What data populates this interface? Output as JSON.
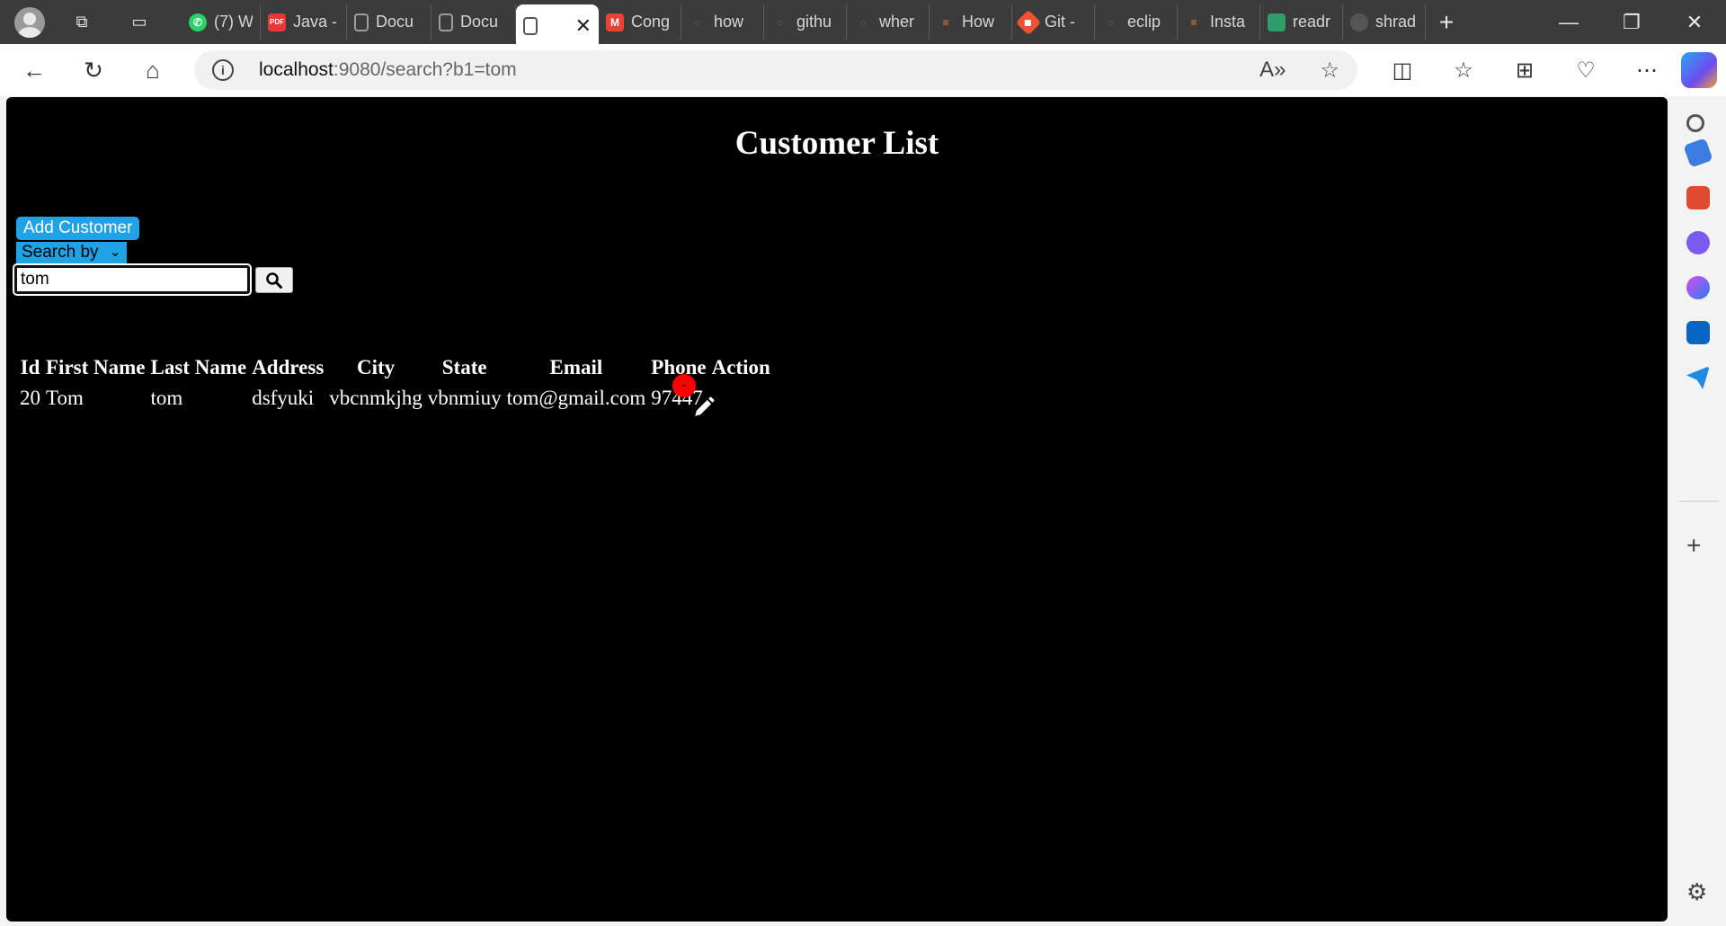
{
  "browser": {
    "tabs": [
      {
        "title": "(7) W",
        "icon": "whatsapp-icon",
        "color": "#25d366"
      },
      {
        "title": "Java -",
        "icon": "pdf-icon",
        "color": "#e53935"
      },
      {
        "title": "Docu",
        "icon": "document-icon",
        "color": "#9e9e9e"
      },
      {
        "title": "Docu",
        "icon": "document-icon",
        "color": "#9e9e9e"
      },
      {
        "title": "",
        "icon": "document-icon",
        "color": "#555555",
        "active": true
      },
      {
        "title": "Cong",
        "icon": "gmail-icon",
        "color": "#ea4335"
      },
      {
        "title": "how",
        "icon": "search-icon",
        "color": "#3b6ea8"
      },
      {
        "title": "githu",
        "icon": "search-icon",
        "color": "#3b6ea8"
      },
      {
        "title": "wher",
        "icon": "search-icon",
        "color": "#3b6ea8"
      },
      {
        "title": "How",
        "icon": "stackoverflow-icon",
        "color": "#f48024"
      },
      {
        "title": "Git -",
        "icon": "git-icon",
        "color": "#f05133"
      },
      {
        "title": "eclip",
        "icon": "search-icon",
        "color": "#3b6ea8"
      },
      {
        "title": "Insta",
        "icon": "stackoverflow-icon",
        "color": "#f48024"
      },
      {
        "title": "readr",
        "icon": "app-icon",
        "color": "#2e9e6b"
      },
      {
        "title": "shrad",
        "icon": "github-icon",
        "color": "#555555"
      }
    ],
    "address": {
      "host": "localhost",
      "rest": ":9080/search?b1=tom"
    }
  },
  "page": {
    "title": "Customer List",
    "add_button": "Add Customer",
    "search_select": "Search by",
    "search_value": "tom",
    "table": {
      "headers": [
        "Id",
        "First Name",
        "Last Name",
        "Address",
        "City",
        "State",
        "Email",
        "Phone",
        "Action"
      ],
      "rows": [
        [
          "20",
          "Tom",
          "tom",
          "dsfyuki",
          "vbcnmkjhg",
          "vbnmiuy",
          "tom@gmail.com",
          "97447"
        ]
      ]
    }
  },
  "colors": {
    "page_bg": "#000000",
    "accent": "#1fa3e6",
    "delete": "#ff0000"
  }
}
